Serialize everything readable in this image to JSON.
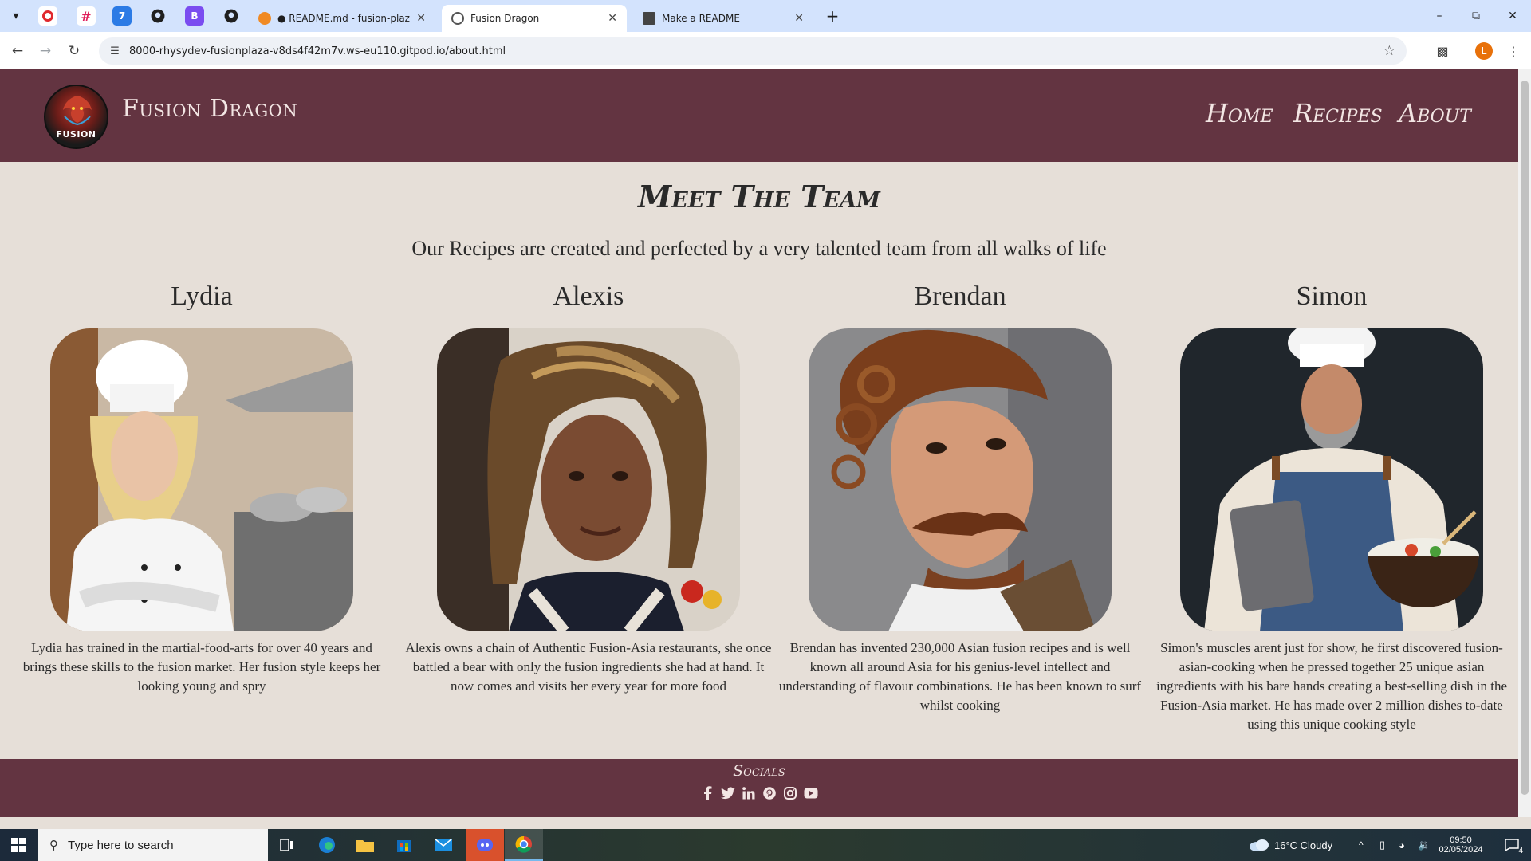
{
  "browser": {
    "tabs": [
      {
        "label": "● README.md - fusion-plaza -",
        "active": false
      },
      {
        "label": "Fusion Dragon",
        "active": true
      },
      {
        "label": "Make a README",
        "active": false
      }
    ],
    "url": "8000-rhysydev-fusionplaza-v8ds4f42m7v.ws-eu110.gitpod.io/about.html",
    "profile_initial": "L"
  },
  "site": {
    "brand": "Fusion Dragon",
    "logo_text": "FUSION",
    "nav": [
      "Home",
      "Recipes",
      "About"
    ]
  },
  "page": {
    "title": "Meet The Team",
    "subtitle": "Our Recipes are created and perfected by a very talented team from all walks of life",
    "members": [
      {
        "name": "Lydia",
        "bio": "Lydia has trained in the martial-food-arts for over 40 years and brings these skills to the fusion market. Her fusion style keeps her looking young and spry"
      },
      {
        "name": "Alexis",
        "bio": "Alexis owns a chain of Authentic Fusion-Asia restaurants, she once battled a bear with only the fusion ingredients she had at hand. It now comes and visits her every year for more food"
      },
      {
        "name": "Brendan",
        "bio": "Brendan has invented 230,000 Asian fusion recipes and is well known all around Asia for his genius-level intellect and understanding of flavour combinations. He has been known to surf whilst cooking"
      },
      {
        "name": "Simon",
        "bio": "Simon's muscles arent just for show, he first discovered fusion-asian-cooking when he pressed together 25 unique asian ingredients with his bare hands creating a best-selling dish in the Fusion-Asia market. He has made over 2 million dishes to-date using this unique cooking style"
      }
    ]
  },
  "footer": {
    "socials_title": "Socials",
    "icons": [
      "facebook-icon",
      "twitter-icon",
      "linkedin-icon",
      "pinterest-icon",
      "instagram-icon",
      "youtube-icon"
    ]
  },
  "taskbar": {
    "search_placeholder": "Type here to search",
    "weather": "16°C  Cloudy",
    "time": "09:50",
    "date": "02/05/2024",
    "notifications": "4"
  },
  "colors": {
    "brand": "#633441",
    "page_bg": "#e6dfd8",
    "tab_strip": "#d3e3fd"
  }
}
